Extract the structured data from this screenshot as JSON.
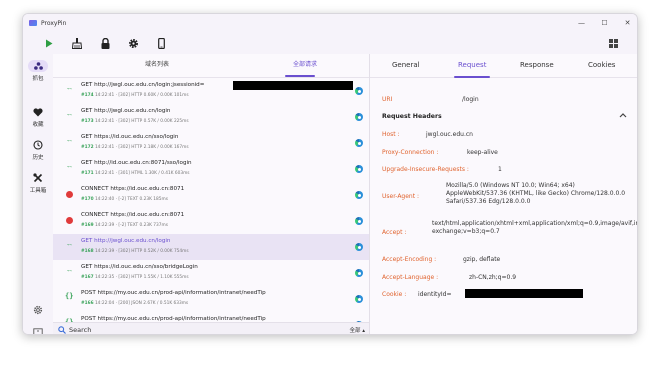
{
  "app": {
    "title": "ProxyPin"
  },
  "window_controls": {
    "minimize": "—",
    "maximize": "☐",
    "close": "✕"
  },
  "toolbar": [
    {
      "name": "start-icon",
      "color": "#2f9e44"
    },
    {
      "name": "clean-icon"
    },
    {
      "name": "lock-icon"
    },
    {
      "name": "settings-icon"
    },
    {
      "name": "phone-icon"
    }
  ],
  "sidebar": {
    "items": [
      {
        "label": "抓包",
        "icon": "capture-icon",
        "active": true
      },
      {
        "label": "收藏",
        "icon": "heart-icon"
      },
      {
        "label": "历史",
        "icon": "history-icon"
      },
      {
        "label": "工具箱",
        "icon": "tools-icon"
      }
    ],
    "bottom": [
      {
        "icon": "settings-icon"
      },
      {
        "icon": "feedback-icon"
      }
    ]
  },
  "list": {
    "tabs": [
      {
        "label": "域名列表",
        "active": false
      },
      {
        "label": "全部请求",
        "active": true
      }
    ],
    "rows": [
      {
        "kind": "http",
        "url": "GET http://jwgl.ouc.edu.cn/login;jsessionid=",
        "num": "#174",
        "meta": "14:22:41 · [302]  HTTP 0.60K / 0.00K  101ms",
        "redacted": true
      },
      {
        "kind": "http",
        "url": "GET http://jwgl.ouc.edu.cn/login",
        "num": "#173",
        "meta": "14:22:41 · [302]  HTTP 0.57K / 0.00K  225ms"
      },
      {
        "kind": "http",
        "url": "GET https://id.ouc.edu.cn/sso/login",
        "num": "#172",
        "meta": "14:22:41 · [302]  HTTP 2.18K / 0.00K  167ms"
      },
      {
        "kind": "http",
        "url": "GET http://id.ouc.edu.cn:8071/sso/login",
        "num": "#171",
        "meta": "14:22:41 · [301]  HTML 1.30K / 0.41K  603ms"
      },
      {
        "kind": "error",
        "url": "CONNECT https://id.ouc.edu.cn:8071",
        "num": "#170",
        "meta": "14:22:40 · [-2]  TEXT 0.23K  185ms"
      },
      {
        "kind": "error",
        "url": "CONNECT https://id.ouc.edu.cn:8071",
        "num": "#169",
        "meta": "14:22:39 · [-2]  TEXT 0.23K  737ms"
      },
      {
        "kind": "http",
        "url": "GET http://jwgl.ouc.edu.cn/login",
        "num": "#168",
        "meta": "14:22:39 · [302]  HTTP 0.52K / 0.00K  754ms",
        "selected": true
      },
      {
        "kind": "http",
        "url": "GET https://id.ouc.edu.cn/sso/bridgeLogin",
        "num": "#167",
        "meta": "14:22:35 · [302]  HTTP 1.55K / 1.10K  555ms"
      },
      {
        "kind": "json",
        "url": "POST https://my.ouc.edu.cn/prod-api/information/intranet/needTip",
        "num": "#166",
        "meta": "14:22:04 · [200]  JSON 2.67K / 0.51K  633ms"
      },
      {
        "kind": "json",
        "url": "POST https://my.ouc.edu.cn/prod-api/information/intranet/needTip",
        "num": "#165",
        "meta": "14:22:02 · [200]  JSON 2.67K / 0.51K  610ms"
      }
    ],
    "search": {
      "placeholder": "Search",
      "filter": "全部 ▴"
    }
  },
  "detail": {
    "tabs": [
      {
        "label": "General",
        "active": false
      },
      {
        "label": "Request",
        "active": true
      },
      {
        "label": "Response",
        "active": false
      },
      {
        "label": "Cookies",
        "active": false
      }
    ],
    "uri": {
      "key": "URI",
      "value": "/login"
    },
    "section_title": "Request Headers",
    "headers": [
      {
        "key": "Host",
        "value": "jwgl.ouc.edu.cn"
      },
      {
        "key": "Proxy-Connection",
        "value": "keep-alive"
      },
      {
        "key": "Upgrade-Insecure-Requests",
        "value": "1"
      },
      {
        "key": "User-Agent",
        "value": "Mozilla/5.0 (Windows NT 10.0; Win64; x64) AppleWebKit/537.36 (KHTML, like Gecko) Chrome/128.0.0.0 Safari/537.36 Edg/128.0.0.0"
      },
      {
        "key": "Accept",
        "value": "text/html,application/xhtml+xml,application/xml;q=0.9,image/avif,image/webp,image/apng,*/*;q=0.8,application/signed-exchange;v=b3;q=0.7"
      },
      {
        "key": "Accept-Encoding",
        "value": "gzip, deflate"
      },
      {
        "key": "Accept-Language",
        "value": "zh-CN,zh;q=0.9"
      },
      {
        "key": "Cookie",
        "value": "identityId=",
        "redacted": true
      }
    ]
  },
  "colors": {
    "accent": "#6a4fcf",
    "key": "#e0632e",
    "ok": "#3aa35a",
    "error": "#e03b3b"
  }
}
